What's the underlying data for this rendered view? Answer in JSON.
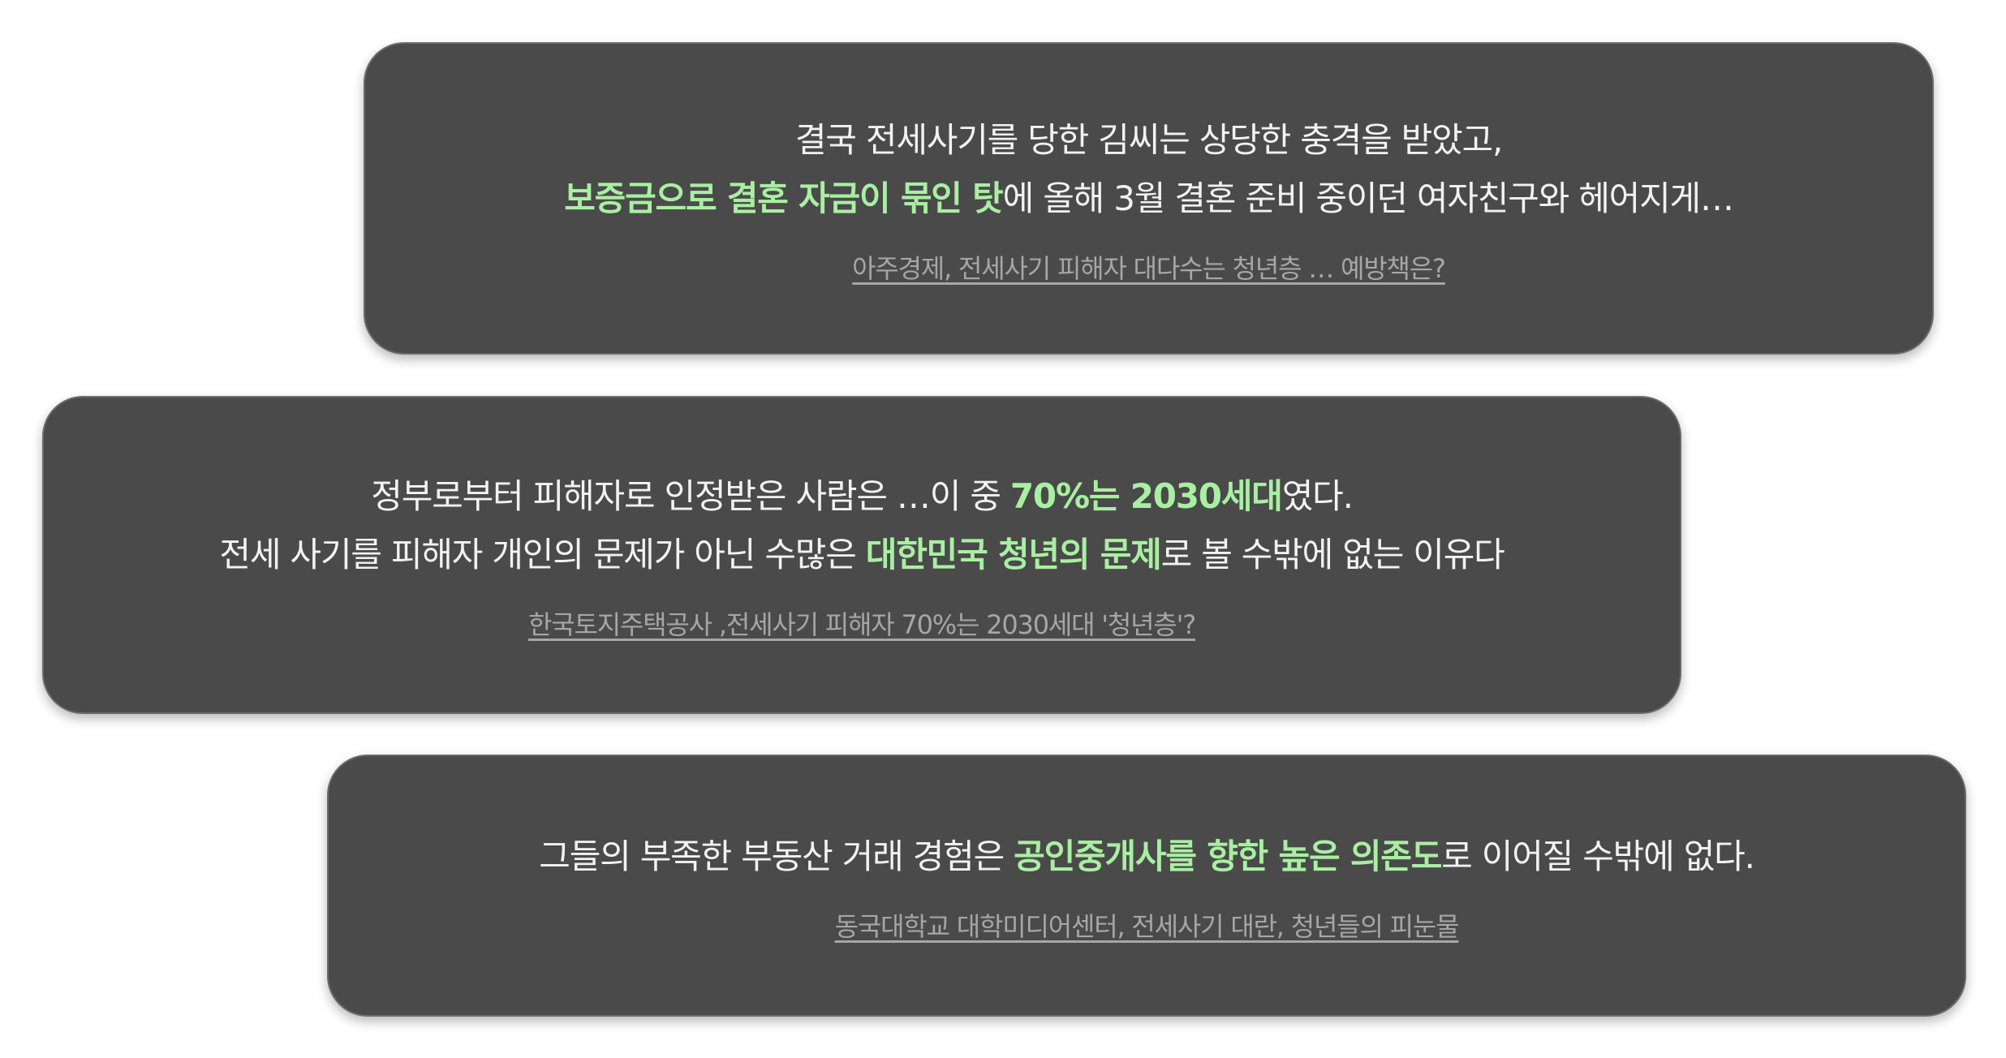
{
  "cards": [
    {
      "line1": "결국 전세사기를 당한 김씨는 상당한 충격을 받았고,",
      "line2_highlight": "보증금으로 결혼 자금이 묶인 탓",
      "line2_rest": "에 올해 3월 결혼 준비 중이던 여자친구와 헤어지게…",
      "source": "아주경제, 전세사기 피해자 대다수는 청년층 … 예방책은?"
    },
    {
      "line1_pre": "정부로부터 피해자로 인정받은 사람은 …이 중 ",
      "line1_highlight": "70%는 2030세대",
      "line1_post": "였다.",
      "line2_pre": "전세 사기를 피해자 개인의 문제가 아닌 수많은 ",
      "line2_highlight": "대한민국 청년의 문제",
      "line2_post": "로 볼 수밖에 없는 이유다",
      "source": "한국토지주택공사 ,전세사기 피해자 70%는 2030세대 '청년층'?"
    },
    {
      "line1_pre": "그들의 부족한 부동산 거래 경험은 ",
      "line1_highlight": "공인중개사를 향한 높은 의존도",
      "line1_post": "로 이어질 수밖에 없다.",
      "source": "동국대학교 대학미디어센터, 전세사기 대란, 청년들의 피눈물"
    }
  ],
  "colors": {
    "card_background": "#4a4a4a",
    "text": "#f2f2f2",
    "highlight": "#a9efa2",
    "source_link": "#a6a6a6"
  }
}
